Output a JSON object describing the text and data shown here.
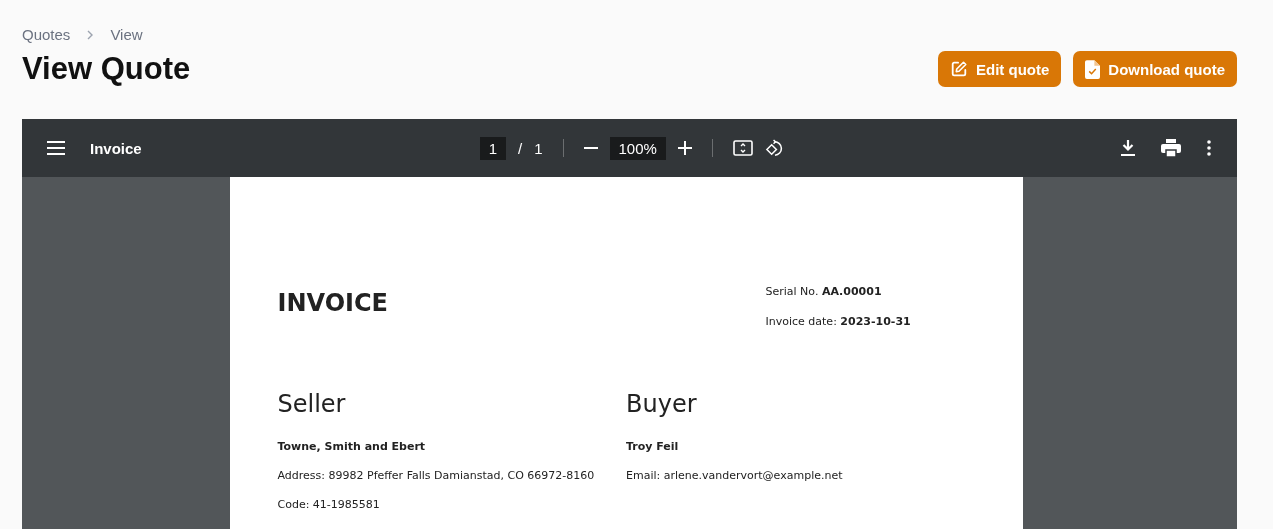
{
  "breadcrumb": [
    "Quotes",
    "View"
  ],
  "title": "View Quote",
  "actions": [
    {
      "kind": "edit",
      "label": "Edit quote"
    },
    {
      "kind": "download",
      "label": "Download quote"
    }
  ],
  "viewer": {
    "title": "Invoice",
    "page_current": "1",
    "page_separator": "/",
    "page_total": "1",
    "zoom": "100%"
  },
  "document": {
    "heading": "INVOICE",
    "meta": [
      "Serial No. **AA.00001**",
      "Invoice date: **2023-10-31**"
    ],
    "parties": [
      {
        "heading": "Seller",
        "name": "Towne, Smith and Ebert",
        "lines": [
          "Address: 89982 Pfeffer Falls Damianstad, CO 66972-8160",
          "Code: 41-1985581"
        ]
      },
      {
        "heading": "Buyer",
        "name": "Troy Feil",
        "lines": [
          "Email: arlene.vandervort@example.net"
        ]
      }
    ]
  }
}
